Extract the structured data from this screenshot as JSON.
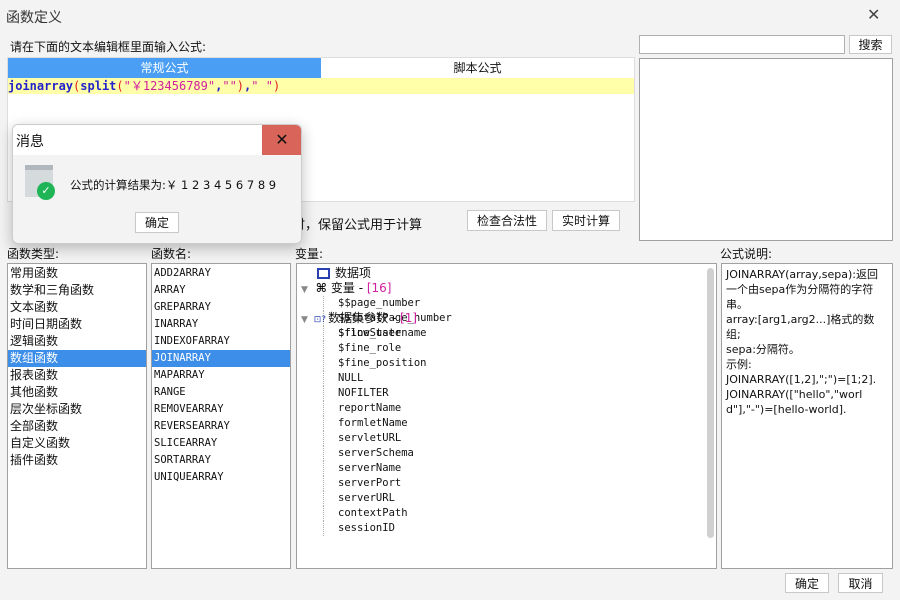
{
  "window": {
    "title": "函数定义",
    "close": "✕"
  },
  "prompt": "请在下面的文本编辑框里面输入公式:",
  "search": {
    "value": "",
    "button": "搜索"
  },
  "tabs": [
    {
      "label": "常规公式",
      "active": true
    },
    {
      "label": "脚本公式",
      "active": false
    }
  ],
  "formula": {
    "fn1": "joinarray",
    "p1": "(",
    "fn2": "split",
    "p2": "(",
    "s1": "\"￥123456789\"",
    "c1": ",",
    "s2": "\"\"",
    "p3": ")",
    "c2": ",",
    "s3": "\" \"",
    "p4": ")"
  },
  "hint_partial": "时，保留公式用于计算",
  "buttons": {
    "check": "检查合法性",
    "realtime": "实时计算",
    "ok": "确定",
    "cancel": "取消"
  },
  "labels": {
    "types": "函数类型:",
    "names": "函数名:",
    "vars": "变量:",
    "desc": "公式说明:"
  },
  "function_types": [
    "常用函数",
    "数学和三角函数",
    "文本函数",
    "时间日期函数",
    "逻辑函数",
    "数组函数",
    "报表函数",
    "其他函数",
    "层次坐标函数",
    "全部函数",
    "自定义函数",
    "插件函数"
  ],
  "selected_type": 5,
  "function_names": [
    "ADD2ARRAY",
    "ARRAY",
    "GREPARRAY",
    "INARRAY",
    "INDEXOFARRAY",
    "JOINARRAY",
    "MAPARRAY",
    "RANGE",
    "REMOVEARRAY",
    "REVERSEARRAY",
    "SLICEARRAY",
    "SORTARRAY",
    "UNIQUEARRAY"
  ],
  "selected_name": 5,
  "variables": {
    "data_item": "数据项",
    "var_group": {
      "label": "变量 - ",
      "count": "[16]"
    },
    "vars": [
      "$$page_number",
      "$$totalPage_number",
      "$fine_username",
      "$fine_role",
      "$fine_position",
      "NULL",
      "NOFILTER",
      "reportName",
      "formletName",
      "servletURL",
      "serverSchema",
      "serverName",
      "serverPort",
      "serverURL",
      "contextPath",
      "sessionID"
    ],
    "dataset_group": {
      "label": "数据集参数 - ",
      "count": "[1]"
    },
    "dataset_params": [
      "$flowState"
    ]
  },
  "description": [
    "JOINARRAY(array,sepa):返回一个由sepa作为分隔符的字符串。",
    "array:[arg1,arg2...]格式的数组;",
    "sepa:分隔符。",
    "示例:",
    "JOINARRAY([1,2],\";\")=[1;2].",
    "JOINARRAY([\"hello\",\"world\"],\"-\")=[hello-world]."
  ],
  "dialog": {
    "title": "消息",
    "message": "公式的计算结果为:￥ 1 2 3 4 5 6 7 8 9",
    "ok": "确定",
    "close": "✕"
  }
}
